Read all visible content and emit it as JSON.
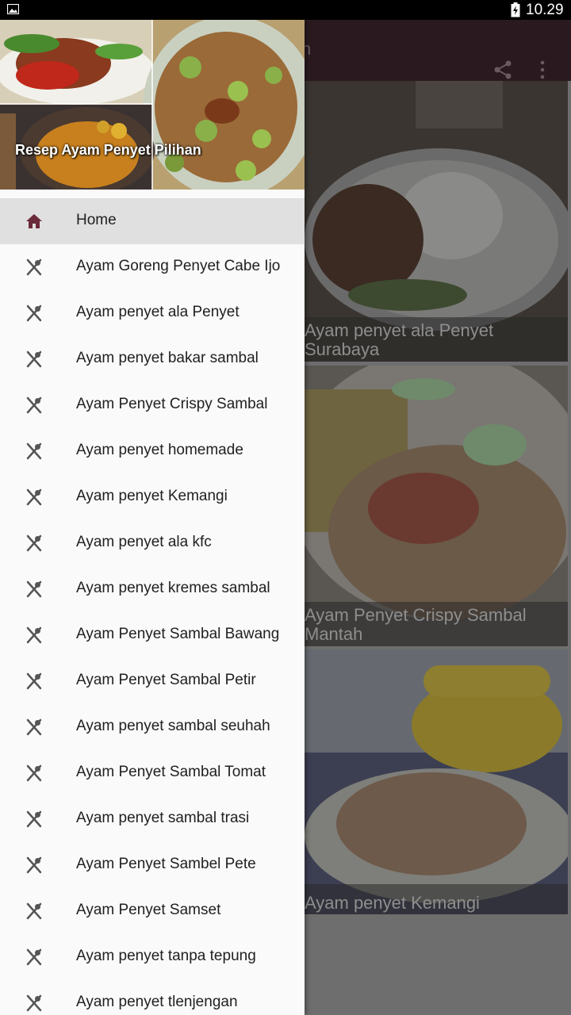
{
  "status_bar": {
    "time": "10.29"
  },
  "app_bar": {
    "title_fragment": "n",
    "share_icon": "share-icon",
    "more_icon": "more-vert-icon"
  },
  "cards": [
    {
      "caption": "Ayam penyet ala Penyet\nSurabaya"
    },
    {
      "caption": "Ayam Penyet Crispy Sambal\nMantah"
    },
    {
      "caption": "Ayam penyet Kemangi"
    }
  ],
  "drawer": {
    "header_title": "Resep Ayam Penyet Pilihan",
    "items": [
      {
        "label": "Home",
        "icon": "home-icon",
        "active": true
      },
      {
        "label": "Ayam Goreng Penyet Cabe Ijo",
        "icon": "fork-spoon-icon"
      },
      {
        "label": "Ayam penyet ala Penyet",
        "icon": "fork-spoon-icon"
      },
      {
        "label": "Ayam penyet bakar sambal",
        "icon": "fork-spoon-icon"
      },
      {
        "label": "Ayam Penyet Crispy Sambal",
        "icon": "fork-spoon-icon"
      },
      {
        "label": "Ayam penyet homemade",
        "icon": "fork-spoon-icon"
      },
      {
        "label": "Ayam penyet Kemangi",
        "icon": "fork-spoon-icon"
      },
      {
        "label": "Ayam penyet ala kfc",
        "icon": "fork-spoon-icon"
      },
      {
        "label": "Ayam penyet kremes sambal",
        "icon": "fork-spoon-icon"
      },
      {
        "label": "Ayam Penyet Sambal Bawang",
        "icon": "fork-spoon-icon"
      },
      {
        "label": "Ayam Penyet Sambal Petir",
        "icon": "fork-spoon-icon"
      },
      {
        "label": "Ayam penyet sambal seuhah",
        "icon": "fork-spoon-icon"
      },
      {
        "label": "Ayam Penyet Sambal Tomat",
        "icon": "fork-spoon-icon"
      },
      {
        "label": "Ayam penyet sambal trasi",
        "icon": "fork-spoon-icon"
      },
      {
        "label": "Ayam Penyet Sambel Pete",
        "icon": "fork-spoon-icon"
      },
      {
        "label": "Ayam Penyet Samset",
        "icon": "fork-spoon-icon"
      },
      {
        "label": "Ayam penyet tanpa tepung",
        "icon": "fork-spoon-icon"
      },
      {
        "label": "Ayam penyet tlenjengan",
        "icon": "fork-spoon-icon"
      }
    ]
  },
  "colors": {
    "accent": "#6b2a3a",
    "app_bar": "#2a1a20",
    "drawer_bg": "#fafafa",
    "active_row": "#e0e0e0"
  }
}
